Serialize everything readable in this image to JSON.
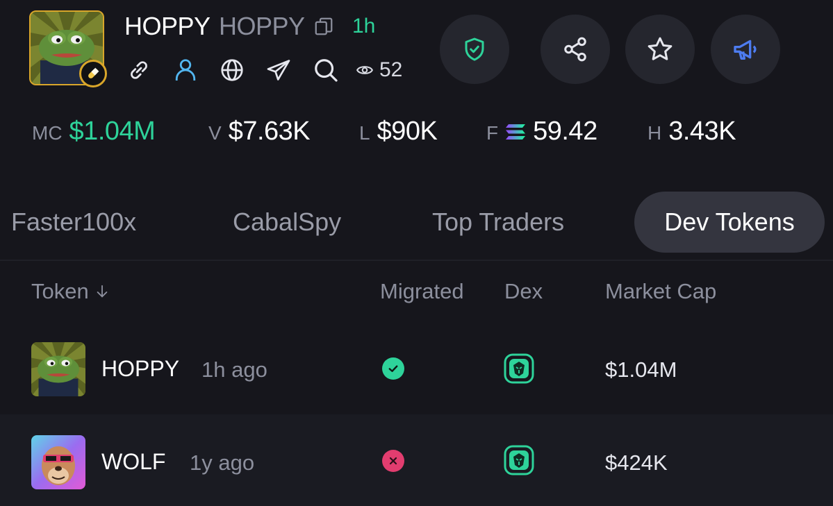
{
  "token": {
    "symbol": "HOPPY",
    "name": "HOPPY",
    "age": "1h",
    "views": "52"
  },
  "stats": {
    "mc": {
      "label": "MC",
      "value": "$1.04M"
    },
    "v": {
      "label": "V",
      "value": "$7.63K"
    },
    "l": {
      "label": "L",
      "value": "$90K"
    },
    "f": {
      "label": "F",
      "value": "59.42"
    },
    "h": {
      "label": "H",
      "value": "3.43K"
    }
  },
  "tabs": [
    "Faster100x",
    "CabalSpy",
    "Top Traders",
    "Dev Tokens"
  ],
  "active_tab": "Dev Tokens",
  "table": {
    "headers": {
      "token": "Token",
      "migrated": "Migrated",
      "dex": "Dex",
      "market_cap": "Market Cap"
    },
    "rows": [
      {
        "symbol": "HOPPY",
        "age": "1h ago",
        "migrated": true,
        "market_cap": "$1.04M"
      },
      {
        "symbol": "WOLF",
        "age": "1y ago",
        "migrated": false,
        "market_cap": "$424K"
      }
    ]
  },
  "colors": {
    "accent_green": "#2ed39a",
    "accent_red": "#e23d6f",
    "avatar_border": "#d9a62a",
    "megaphone": "#4d7cf0"
  },
  "icons": [
    "copy-icon",
    "pill-icon",
    "link-icon",
    "user-icon",
    "globe-icon",
    "telegram-icon",
    "search-icon",
    "eye-icon",
    "shield-check-icon",
    "share-icon",
    "star-icon",
    "megaphone-icon",
    "solana-icon",
    "arrow-down-icon",
    "check-icon",
    "x-icon",
    "dex-eagle-icon"
  ]
}
